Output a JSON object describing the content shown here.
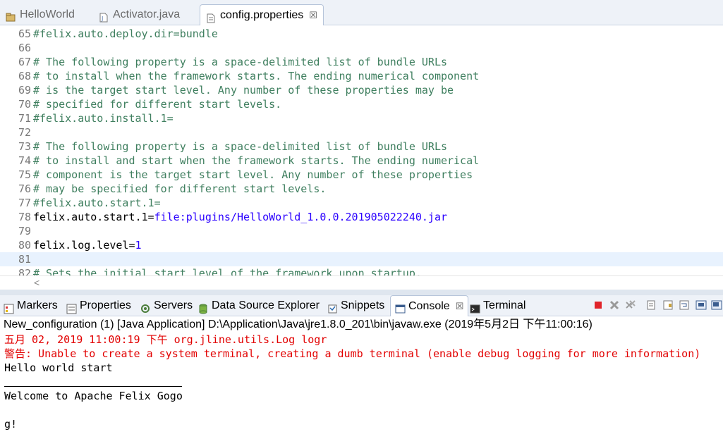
{
  "editor_tabs": [
    {
      "label": "HelloWorld",
      "icon": "project-icon",
      "active": false
    },
    {
      "label": "Activator.java",
      "icon": "java-file-icon",
      "active": false
    },
    {
      "label": "config.properties",
      "icon": "properties-file-icon",
      "active": true,
      "close": "☒"
    }
  ],
  "code": [
    {
      "n": "65",
      "type": "comment",
      "text": "#felix.auto.deploy.dir=bundle"
    },
    {
      "n": "66",
      "type": "blank",
      "text": ""
    },
    {
      "n": "67",
      "type": "comment",
      "text": "# The following property is a space-delimited list of bundle URLs"
    },
    {
      "n": "68",
      "type": "comment",
      "text": "# to install when the framework starts. The ending numerical component"
    },
    {
      "n": "69",
      "type": "comment",
      "text": "# is the target start level. Any number of these properties may be"
    },
    {
      "n": "70",
      "type": "comment",
      "text": "# specified for different start levels."
    },
    {
      "n": "71",
      "type": "comment",
      "text": "#felix.auto.install.1="
    },
    {
      "n": "72",
      "type": "blank",
      "text": ""
    },
    {
      "n": "73",
      "type": "comment",
      "text": "# The following property is a space-delimited list of bundle URLs"
    },
    {
      "n": "74",
      "type": "comment",
      "text": "# to install and start when the framework starts. The ending numerical"
    },
    {
      "n": "75",
      "type": "comment",
      "text": "# component is the target start level. Any number of these properties"
    },
    {
      "n": "76",
      "type": "comment",
      "text": "# may be specified for different start levels."
    },
    {
      "n": "77",
      "type": "comment",
      "text": "#felix.auto.start.1="
    },
    {
      "n": "78",
      "type": "property",
      "key": "felix.auto.start.1=",
      "value": "file:plugins/HelloWorld_1.0.0.201905022240.jar"
    },
    {
      "n": "79",
      "type": "blank",
      "text": ""
    },
    {
      "n": "80",
      "type": "property",
      "key": "felix.log.level=",
      "value": "1"
    },
    {
      "n": "81",
      "type": "blank",
      "text": "",
      "current": true
    },
    {
      "n": "82",
      "type": "comment",
      "text": "# Sets the initial start level of the framework upon startup."
    }
  ],
  "view_tabs": [
    {
      "label": "Markers",
      "icon": "markers-icon",
      "active": false
    },
    {
      "label": "Properties",
      "icon": "properties-view-icon",
      "active": false
    },
    {
      "label": "Servers",
      "icon": "servers-icon",
      "active": false
    },
    {
      "label": "Data Source Explorer",
      "icon": "data-source-icon",
      "active": false
    },
    {
      "label": "Snippets",
      "icon": "snippets-icon",
      "active": false
    },
    {
      "label": "Console",
      "icon": "console-icon",
      "active": true,
      "close": "☒"
    },
    {
      "label": "Terminal",
      "icon": "terminal-icon",
      "active": false
    }
  ],
  "toolbar_icons": [
    "terminate-icon",
    "remove-launch-icon",
    "remove-all-terminated-icon",
    "clear-console-icon",
    "scroll-lock-icon",
    "word-wrap-icon",
    "pin-console-icon",
    "display-selected-console-icon"
  ],
  "console": {
    "header": "New_configuration (1) [Java Application] D:\\Application\\Java\\jre1.8.0_201\\bin\\javaw.exe (2019年5月2日 下午11:00:16)",
    "lines": [
      {
        "text": "五月 02, 2019 11:00:19 下午 org.jline.utils.Log logr",
        "style": "error"
      },
      {
        "text": "警告: Unable to create a system terminal, creating a dumb terminal (enable debug logging for more information)",
        "style": "error"
      },
      {
        "text": "Hello world start",
        "style": "normal"
      },
      {
        "text": "Welcome to Apache Felix Gogo",
        "style": "normal"
      },
      {
        "text": "g!",
        "style": "normal"
      }
    ]
  },
  "colors": {
    "comment": "#3f7f5f",
    "value": "#2a00ff",
    "error": "#e20000",
    "current_line": "#e8f2fe"
  }
}
